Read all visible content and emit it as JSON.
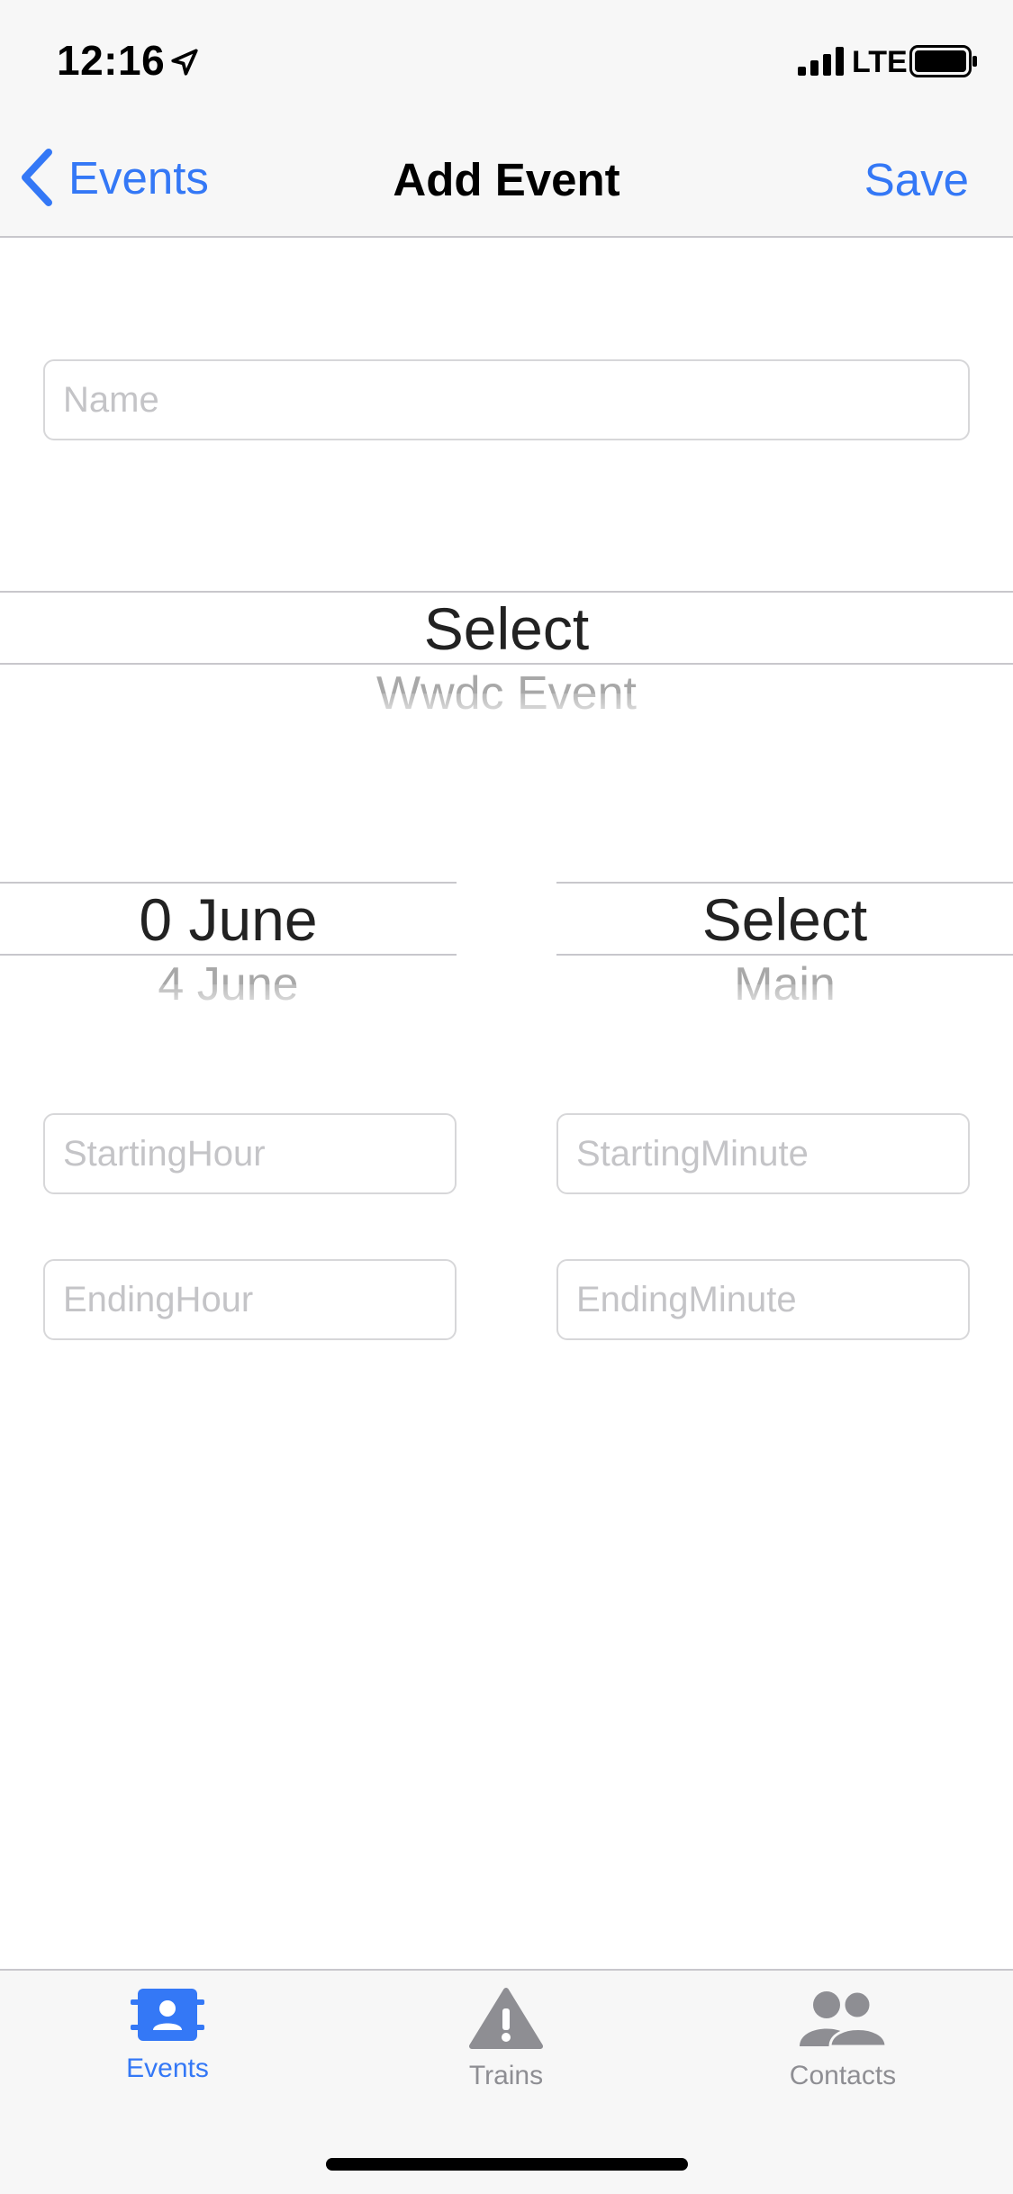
{
  "status_bar": {
    "time": "12:16",
    "network": "LTE",
    "icons": [
      "location-arrow-icon",
      "signal-bars-icon",
      "battery-icon"
    ]
  },
  "nav": {
    "back_label": "Events",
    "title": "Add Event",
    "save_label": "Save",
    "accent_color": "#3478f6"
  },
  "form": {
    "name_placeholder": "Name",
    "name_value": "",
    "event_picker": {
      "selected": "Select",
      "next": "Wwdc Event"
    },
    "date_picker": {
      "selected": "0 June",
      "next": "4 June"
    },
    "location_picker": {
      "selected": "Select",
      "next": "Main"
    },
    "starting_hour_placeholder": "StartingHour",
    "starting_minute_placeholder": "StartingMinute",
    "ending_hour_placeholder": "EndingHour",
    "ending_minute_placeholder": "EndingMinute"
  },
  "tab_bar": {
    "tabs": [
      {
        "label": "Events",
        "icon": "events-icon",
        "active": true
      },
      {
        "label": "Trains",
        "icon": "warning-triangle-icon",
        "active": false
      },
      {
        "label": "Contacts",
        "icon": "contacts-icon",
        "active": false
      }
    ],
    "active_color": "#3478f6",
    "inactive_color": "#8e8e93"
  }
}
